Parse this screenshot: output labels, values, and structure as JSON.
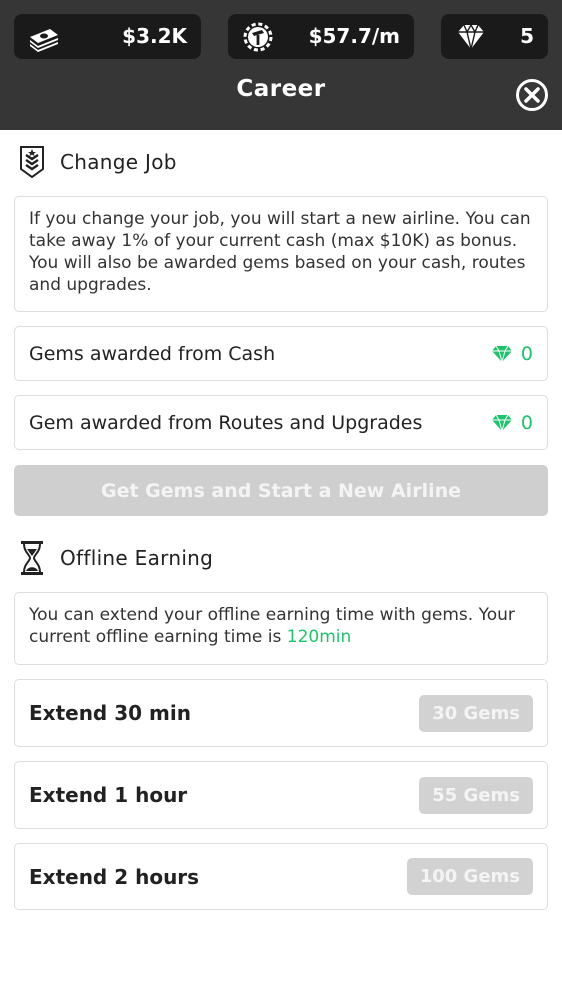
{
  "header": {
    "cash": "$3.2K",
    "income": "$57.7/m",
    "gems": "5",
    "title": "Career"
  },
  "change_job": {
    "heading": "Change Job",
    "description": "If you change your job, you will start a new airline. You can take away 1% of your current cash (max $10K) as bonus. You will also be awarded gems based on your cash, routes and upgrades.",
    "rows": [
      {
        "label": "Gems awarded from Cash",
        "value": "0"
      },
      {
        "label": "Gem awarded from Routes and Upgrades",
        "value": "0"
      }
    ],
    "button_label": "Get Gems and Start a New Airline"
  },
  "offline": {
    "heading": "Offline Earning",
    "description_prefix": "You can extend your offline earning time with gems. Your current offline earning time is ",
    "current_time": "120min",
    "options": [
      {
        "label": "Extend 30 min",
        "cost": "30 Gems"
      },
      {
        "label": "Extend 1 hour",
        "cost": "55 Gems"
      },
      {
        "label": "Extend 2 hours",
        "cost": "100 Gems"
      }
    ]
  },
  "colors": {
    "header_bg": "#363636",
    "accent_green": "#1ec46b",
    "disabled_button": "#cfcfcf"
  },
  "icons": {
    "cash": "money-stack-icon",
    "income": "gear-hammer-icon",
    "gems": "diamond-icon",
    "close": "close-circle-icon",
    "change_job": "rank-badge-icon",
    "offline": "hourglass-icon"
  }
}
